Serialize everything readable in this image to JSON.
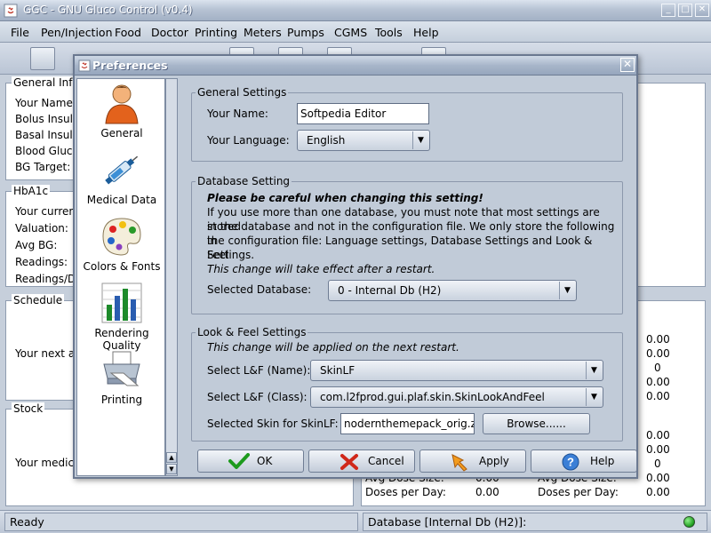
{
  "window": {
    "title": "GGC - GNU Gluco Control (v0.4)"
  },
  "menu": [
    "File",
    "Pen/Injection",
    "Food",
    "Doctor",
    "Printing",
    "Meters",
    "Pumps",
    "CGMS",
    "Tools",
    "Help"
  ],
  "background": {
    "general_info": {
      "title": "General Info",
      "labels": [
        "Your Name:",
        "Bolus Insulin",
        "Basal Insulin",
        "Blood Glucos",
        "BG Target:"
      ]
    },
    "hba1c": {
      "title": "HbA1c",
      "labels": [
        "Your current",
        "Valuation:",
        "Avg BG:",
        "Readings:",
        "Readings/Da"
      ]
    },
    "schedule": {
      "title": "Schedule",
      "label": "Your next app"
    },
    "stock": {
      "title": "Stock",
      "label": "Your medica",
      "rows": [
        "Avg Dose Size:",
        "Doses per Day:"
      ]
    },
    "values_col1": [
      "0.00",
      "0.00",
      "0",
      "0.00",
      "0.00",
      "0.00",
      "0.00",
      "0",
      "0.00",
      "0.00"
    ],
    "values_col2": [
      "0.00",
      "0.00"
    ]
  },
  "status": {
    "left": "Ready",
    "right": "Database [Internal Db (H2)]:"
  },
  "dialog": {
    "title": "Preferences",
    "sidebar": [
      "General",
      "Medical Data",
      "Colors & Fonts",
      "Rendering Quality",
      "Printing"
    ],
    "general_settings": {
      "title": "General Settings",
      "name_label": "Your Name:",
      "name_value": "Softpedia Editor",
      "language_label": "Your Language:",
      "language_value": "English"
    },
    "database_setting": {
      "title": "Database Setting",
      "warning": "Please be careful when changing this setting!",
      "line1": "If you use more than one database, you must note that most settings are stored",
      "line2": "in the database and not in the configuration file. We only store the following in",
      "line3": "the configuration file: Language settings, Database Settings and Look & Feel",
      "line4": "Settings.",
      "restart_note": "This change will take effect after a restart.",
      "db_label": "Selected Database:",
      "db_value": "0 - Internal Db (H2)"
    },
    "look_feel": {
      "title": "Look & Feel Settings",
      "note": "This change will be applied on the next restart.",
      "name_label": "Select L&F (Name):",
      "name_value": "SkinLF",
      "class_label": "Select L&F (Class):",
      "class_value": "com.l2fprod.gui.plaf.skin.SkinLookAndFeel",
      "skin_label": "Selected Skin for SkinLF:",
      "skin_value": "nodernthemepack_orig.zip",
      "browse_label": "Browse......"
    },
    "buttons": {
      "ok": "OK",
      "cancel": "Cancel",
      "apply": "Apply",
      "help": "Help"
    }
  }
}
